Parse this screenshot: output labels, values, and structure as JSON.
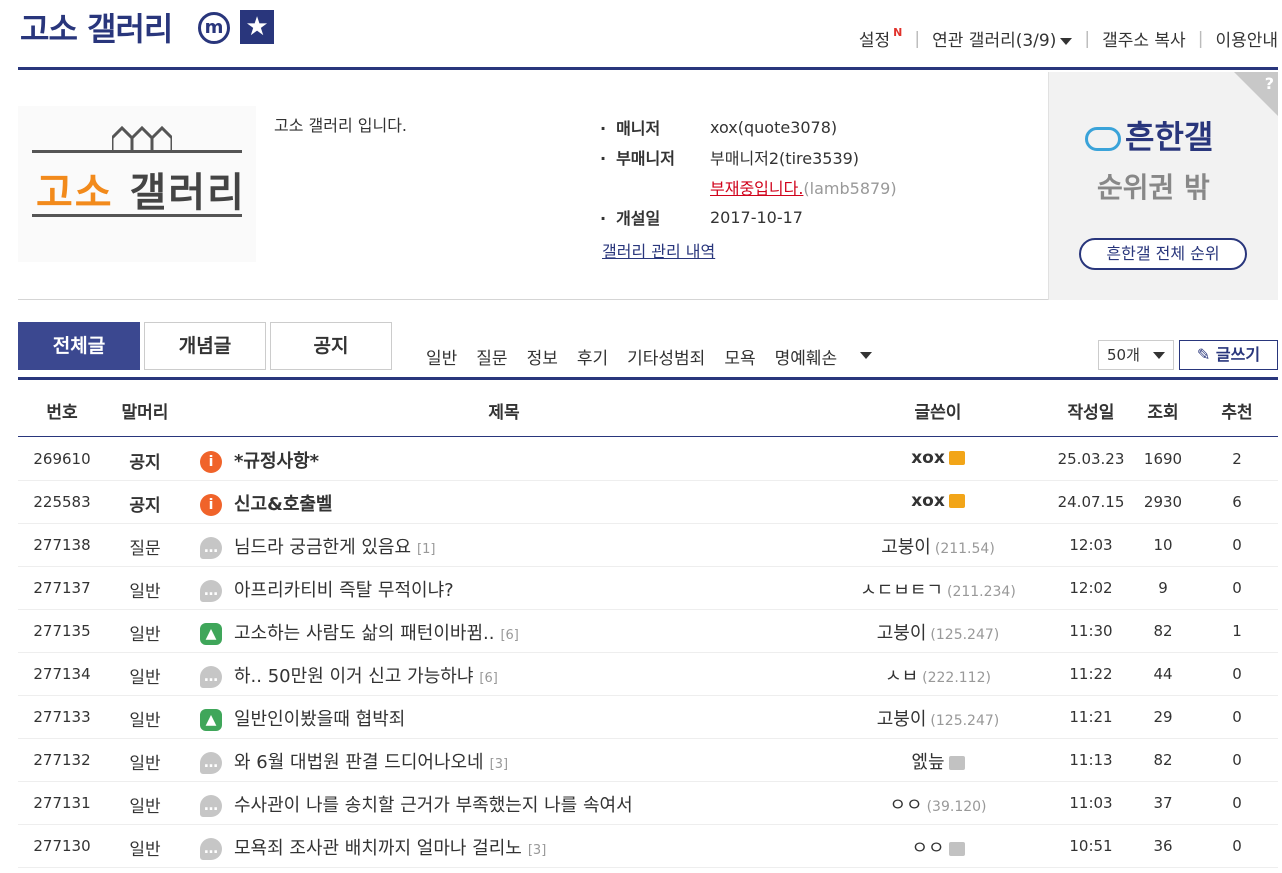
{
  "header": {
    "gallery_title": "고소 갤러리",
    "mini_badge": "m",
    "star_badge": "★",
    "links": {
      "settings": "설정",
      "settings_new": "N",
      "related": "연관 갤러리(3/9)",
      "copy_addr": "갤주소 복사",
      "guide": "이용안내"
    }
  },
  "info": {
    "logo_text_orange": "고소",
    "logo_text_dark": " 갤러리",
    "description": "고소 갤러리 입니다.",
    "manager_label": "매니저",
    "manager_value": "xox(quote3078)",
    "submanager_label": "부매니저",
    "submanager_value": "부매니저2(tire3539)",
    "absent_text": "부재중입니다.",
    "absent_id": "(lamb5879)",
    "opened_label": "개설일",
    "opened_value": "2017-10-17",
    "manage_link": "갤러리 관리 내역",
    "rank": {
      "logo": "흔한갤",
      "sub": "순위권 밖",
      "button": "흔한갤 전체 순위",
      "help": "?"
    }
  },
  "tabs": {
    "all": "전체글",
    "concept": "개념글",
    "notice": "공지",
    "heads": [
      "일반",
      "질문",
      "정보",
      "후기",
      "기타성범죄",
      "모욕",
      "명예훼손"
    ],
    "page_size": "50개",
    "write": "글쓰기"
  },
  "table": {
    "columns": {
      "no": "번호",
      "head": "말머리",
      "title": "제목",
      "writer": "글쓴이",
      "date": "작성일",
      "views": "조회",
      "recommend": "추천"
    },
    "rows": [
      {
        "no": "269610",
        "head": "공지",
        "icon": "notice",
        "title": "*규정사항*",
        "comments": "",
        "writer": "xox",
        "ip": "",
        "badge": "fix",
        "date": "25.03.23",
        "views": "1690",
        "rec": "2"
      },
      {
        "no": "225583",
        "head": "공지",
        "icon": "notice",
        "title": "신고&호출벨",
        "comments": "",
        "writer": "xox",
        "ip": "",
        "badge": "fix",
        "date": "24.07.15",
        "views": "2930",
        "rec": "6"
      },
      {
        "no": "277138",
        "head": "질문",
        "icon": "text",
        "title": "님드라 궁금한게 있음요",
        "comments": "[1]",
        "writer": "고붕이",
        "ip": "(211.54)",
        "badge": "",
        "date": "12:03",
        "views": "10",
        "rec": "0"
      },
      {
        "no": "277137",
        "head": "일반",
        "icon": "text",
        "title": "아프리카티비 즉탈 무적이냐?",
        "comments": "",
        "writer": "ㅅㄷㅂㅌㄱ",
        "ip": "(211.234)",
        "badge": "",
        "date": "12:02",
        "views": "9",
        "rec": "0"
      },
      {
        "no": "277135",
        "head": "일반",
        "icon": "image",
        "title": "고소하는 사람도 삶의 패턴이바뀜..",
        "comments": "[6]",
        "writer": "고붕이",
        "ip": "(125.247)",
        "badge": "",
        "date": "11:30",
        "views": "82",
        "rec": "1"
      },
      {
        "no": "277134",
        "head": "일반",
        "icon": "text",
        "title": "하.. 50만원 이거 신고 가능하냐",
        "comments": "[6]",
        "writer": "ㅅㅂ",
        "ip": "(222.112)",
        "badge": "",
        "date": "11:22",
        "views": "44",
        "rec": "0"
      },
      {
        "no": "277133",
        "head": "일반",
        "icon": "image",
        "title": "일반인이봤을때 협박죄",
        "comments": "",
        "writer": "고붕이",
        "ip": "(125.247)",
        "badge": "",
        "date": "11:21",
        "views": "29",
        "rec": "0"
      },
      {
        "no": "277132",
        "head": "일반",
        "icon": "text",
        "title": "와 6월 대법원 판결 드디어나오네",
        "comments": "[3]",
        "writer": "엜늪",
        "ip": "",
        "badge": "half",
        "date": "11:13",
        "views": "82",
        "rec": "0"
      },
      {
        "no": "277131",
        "head": "일반",
        "icon": "text",
        "title": "수사관이 나를 송치할 근거가 부족했는지 나를 속여서",
        "comments": "",
        "writer": "ㅇㅇ",
        "ip": "(39.120)",
        "badge": "",
        "date": "11:03",
        "views": "37",
        "rec": "0"
      },
      {
        "no": "277130",
        "head": "일반",
        "icon": "text",
        "title": "모욕죄 조사관 배치까지 얼마나 걸리노",
        "comments": "[3]",
        "writer": "ㅇㅇ",
        "ip": "",
        "badge": "half",
        "date": "10:51",
        "views": "36",
        "rec": "0"
      }
    ]
  }
}
